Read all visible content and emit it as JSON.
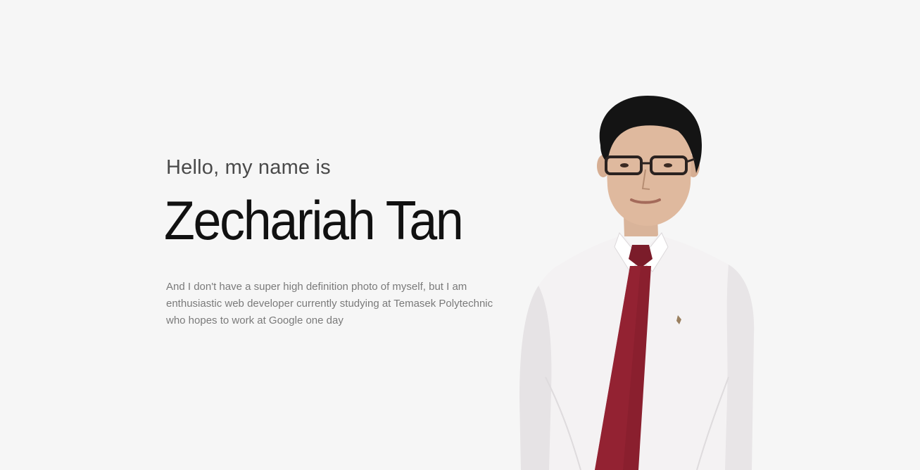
{
  "hero": {
    "greeting": "Hello, my name is",
    "name": "Zechariah Tan",
    "bio": "And I don't have a super high definition photo of myself, but I am enthusiastic web developer currently studying at Temasek Polytechnic who hopes to work at Google one day"
  },
  "colors": {
    "background": "#f6f6f6",
    "greeting": "#4a4a4a",
    "name": "#111111",
    "bio": "#7a7a7a",
    "shirt": "#f4f2f3",
    "tie": "#8a1f2e"
  }
}
